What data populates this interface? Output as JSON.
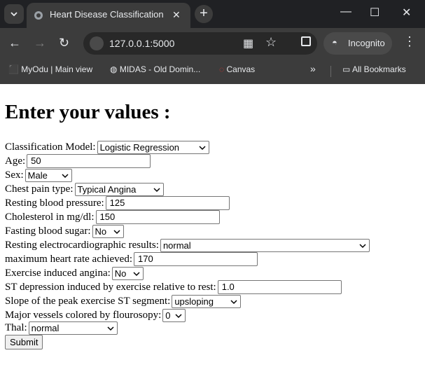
{
  "browser": {
    "tab_title": "Heart Disease Classification",
    "url": "127.0.0.1:5000",
    "incognito_label": "Incognito",
    "bookmarks": [
      "MyOdu | Main view",
      "MIDAS - Old Domin...",
      "Canvas"
    ],
    "all_bookmarks_label": "All Bookmarks"
  },
  "page": {
    "heading": "Enter your values :",
    "fields": {
      "model": {
        "label": "Classification Model:",
        "value": "Logistic Regression"
      },
      "age": {
        "label": "Age:",
        "value": "50"
      },
      "sex": {
        "label": "Sex:",
        "value": "Male"
      },
      "chest_pain": {
        "label": "Chest pain type:",
        "value": "Typical Angina"
      },
      "resting_bp": {
        "label": "Resting blood pressure:",
        "value": "125"
      },
      "cholesterol": {
        "label": "Cholesterol in mg/dl:",
        "value": "150"
      },
      "fasting_sugar": {
        "label": "Fasting blood sugar:",
        "value": "No"
      },
      "rest_ecg": {
        "label": "Resting electrocardiographic results:",
        "value": "normal"
      },
      "max_hr": {
        "label": "maximum heart rate achieved:",
        "value": "170"
      },
      "ex_angina": {
        "label": "Exercise induced angina:",
        "value": "No"
      },
      "st_depression": {
        "label": "ST depression induced by exercise relative to rest:",
        "value": "1.0"
      },
      "slope": {
        "label": "Slope of the peak exercise ST segment:",
        "value": "upsloping"
      },
      "vessels": {
        "label": "Major vessels colored by flourosopy:",
        "value": "0"
      },
      "thal": {
        "label": "Thal:",
        "value": "normal"
      }
    },
    "submit_label": "Submit"
  }
}
